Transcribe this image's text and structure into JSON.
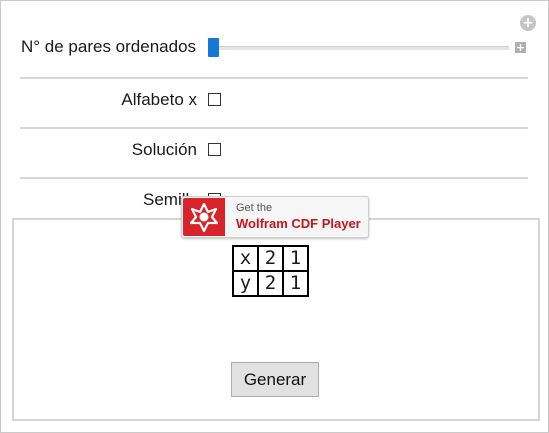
{
  "controls": {
    "pairs_label": "N° de pares ordenados",
    "alphabet_label": "Alfabeto x",
    "solution_label": "Solución",
    "seed_label": "Semill",
    "pairs_level": 0.0
  },
  "icons": {
    "add_circle": "plus-circle-icon",
    "add_box": "plus-box-icon"
  },
  "badge": {
    "line1": "Get the",
    "line2": "Wolfram CDF Player"
  },
  "output": {
    "rows": [
      [
        "x",
        "2",
        "1"
      ],
      [
        "y",
        "2",
        "1"
      ]
    ],
    "button_label": "Generar"
  },
  "colors": {
    "slider_thumb": "#1478d4",
    "badge_red": "#d7232a"
  }
}
